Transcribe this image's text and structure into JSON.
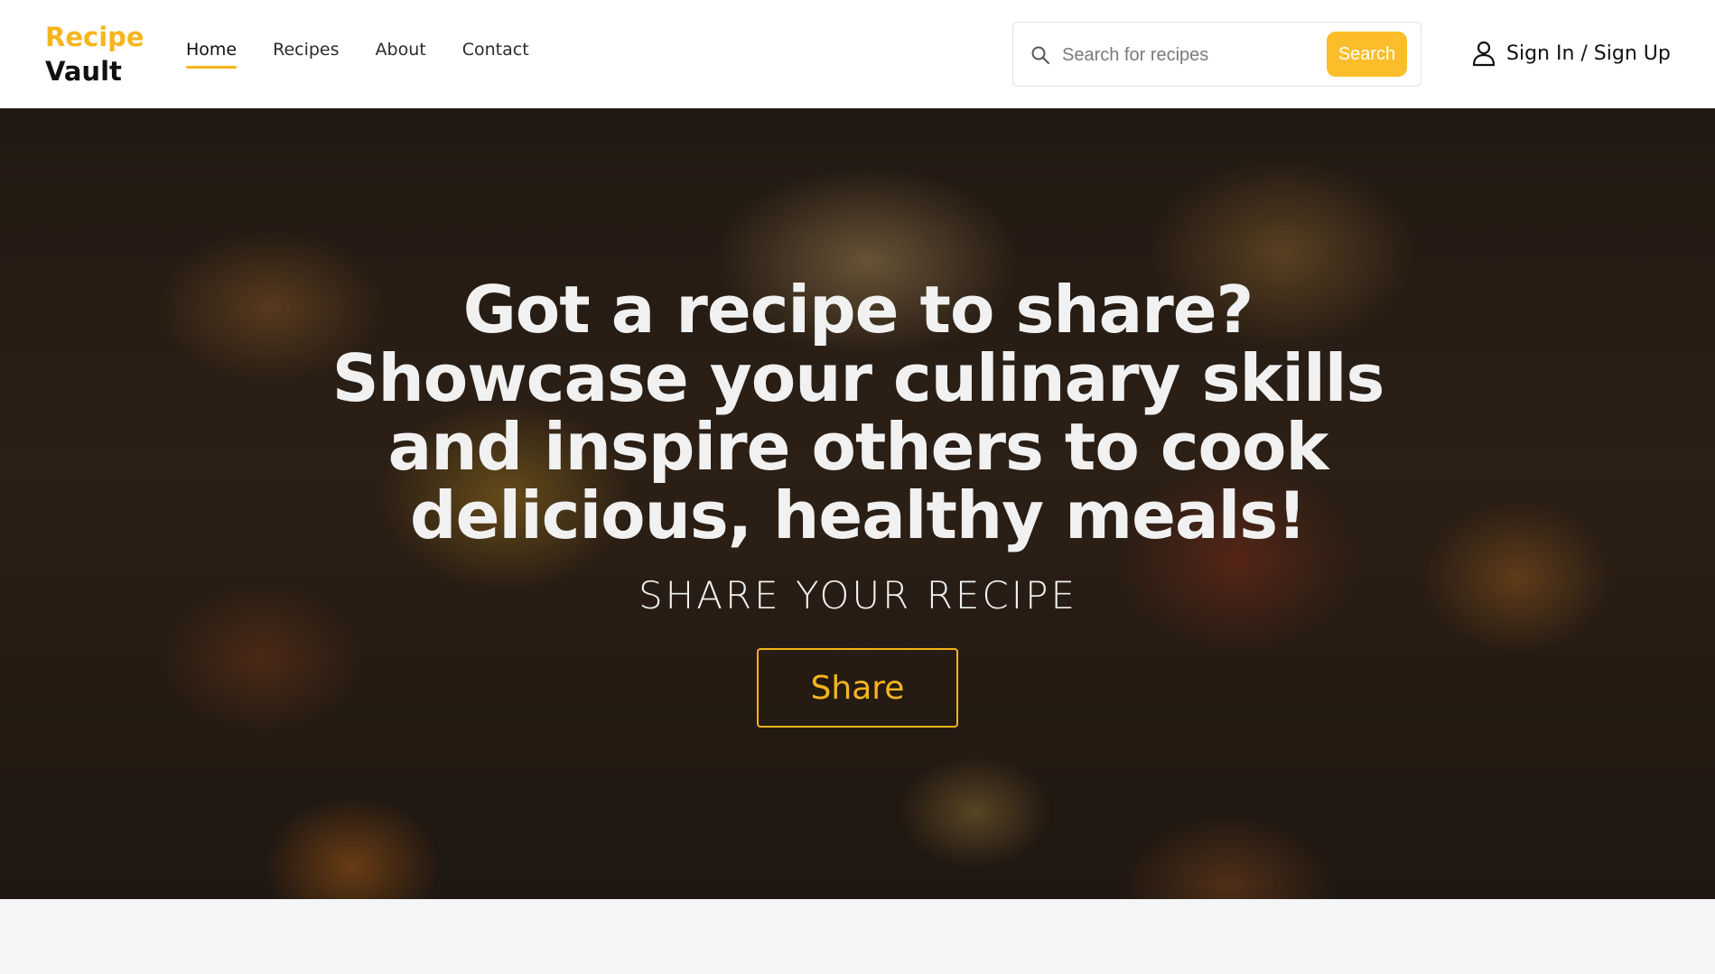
{
  "header": {
    "logo_line1": "Recipe",
    "logo_line2": "Vault",
    "nav": [
      {
        "label": "Home",
        "active": true
      },
      {
        "label": "Recipes",
        "active": false
      },
      {
        "label": "About",
        "active": false
      },
      {
        "label": "Contact",
        "active": false
      }
    ],
    "search": {
      "placeholder": "Search for recipes",
      "button_label": "Search",
      "icon": "search-icon"
    },
    "auth_label": "Sign In / Sign Up",
    "auth_icon": "user-icon"
  },
  "hero": {
    "title": "Got a recipe to share? Showcase your culinary skills and inspire others to cook delicious, healthy meals!",
    "subtitle": "SHARE YOUR RECIPE",
    "button_label": "Share"
  },
  "colors": {
    "accent": "#f6b51d",
    "search_button": "#fbbd2a",
    "hero_text": "#f1f1f1",
    "page_bg": "#f4f5f7"
  }
}
